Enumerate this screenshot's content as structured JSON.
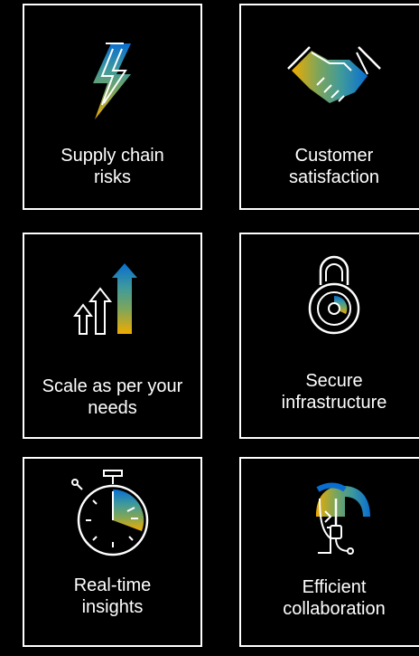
{
  "tiles": [
    {
      "label_lines": [
        "Supply chain",
        "risks"
      ],
      "icon": "lightning-bolt-icon"
    },
    {
      "label_lines": [
        "Customer",
        "satisfaction"
      ],
      "icon": "handshake-icon"
    },
    {
      "label_lines": [
        "Scale as per your",
        "needs"
      ],
      "icon": "scale-arrows-icon"
    },
    {
      "label_lines": [
        "Secure",
        "infrastructure"
      ],
      "icon": "padlock-icon"
    },
    {
      "label_lines": [
        "Real-time",
        "insights"
      ],
      "icon": "stopwatch-icon"
    },
    {
      "label_lines": [
        "Efficient",
        "collaboration"
      ],
      "icon": "headset-person-icon"
    }
  ],
  "colors": {
    "background": "#000000",
    "border": "#ffffff",
    "text": "#ffffff",
    "accent_gold": "#f0ab00",
    "accent_green": "#7ea55a",
    "accent_teal": "#3f9a9b",
    "accent_blue": "#0a6ed1"
  }
}
